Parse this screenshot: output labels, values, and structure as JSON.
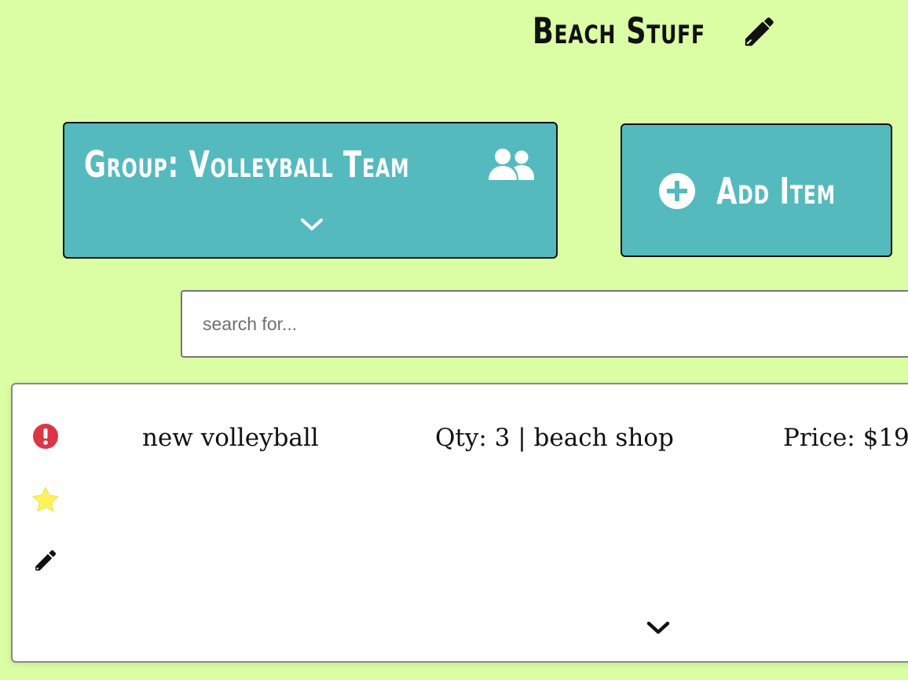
{
  "header": {
    "title": "Beach Stuff",
    "edit_icon": "pencil-icon"
  },
  "group": {
    "label": "Group: Volleyball Team",
    "icon": "users-icon",
    "toggle_icon": "chevron-down-icon"
  },
  "add_item": {
    "label": "Add Item",
    "icon": "plus-circle-icon"
  },
  "search": {
    "placeholder": "search for..."
  },
  "items": [
    {
      "name": "new volleyball",
      "quantity": "Qty: 3 | beach shop",
      "price": "Price: $19",
      "icons": [
        "alert-circle-icon",
        "star-icon",
        "pencil-icon"
      ],
      "expand_icon": "chevron-down-icon"
    }
  ],
  "colors": {
    "background": "#dbfda3",
    "button": "#54babe",
    "alert": "#dc3545",
    "star": "#fff35c",
    "text": "#111111"
  }
}
